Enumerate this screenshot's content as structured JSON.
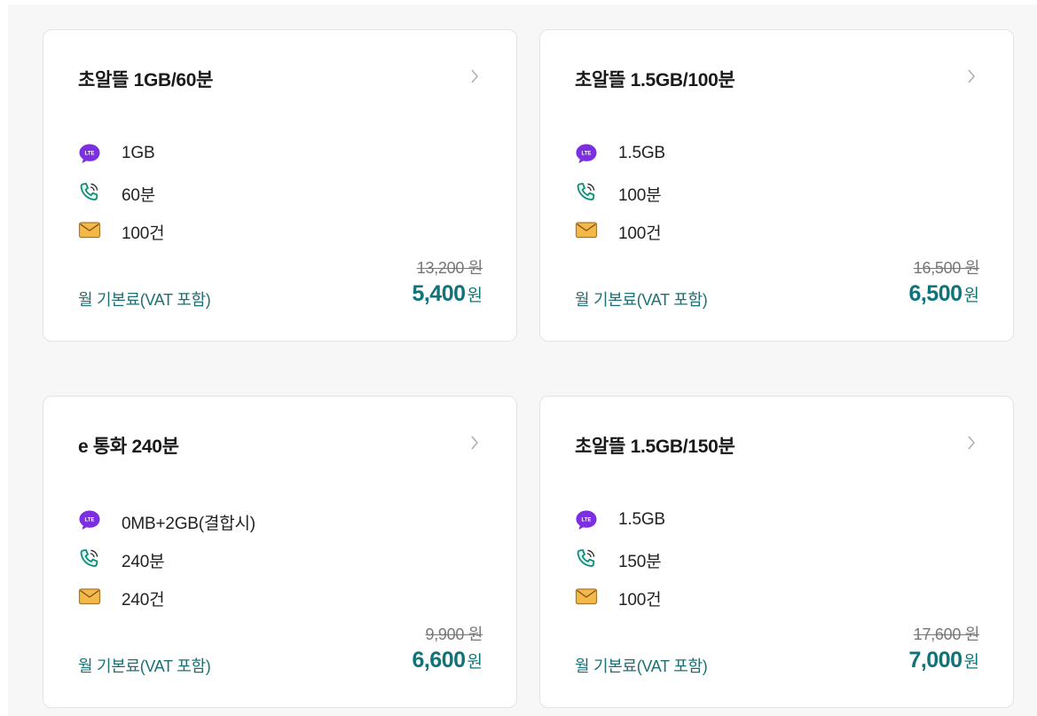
{
  "plans": [
    {
      "title": "초알뜰 1GB/60분",
      "features": {
        "data": "1GB",
        "voice": "60분",
        "sms": "100건"
      },
      "original_price": "13,200 원",
      "fee_label": "월 기본료(VAT 포함)",
      "price": "5,400",
      "price_unit": "원"
    },
    {
      "title": "초알뜰 1.5GB/100분",
      "features": {
        "data": "1.5GB",
        "voice": "100분",
        "sms": "100건"
      },
      "original_price": "16,500 원",
      "fee_label": "월 기본료(VAT 포함)",
      "price": "6,500",
      "price_unit": "원"
    },
    {
      "title": "e 통화 240분",
      "features": {
        "data": "0MB+2GB(결합시)",
        "voice": "240분",
        "sms": "240건"
      },
      "original_price": "9,900 원",
      "fee_label": "월 기본료(VAT 포함)",
      "price": "6,600",
      "price_unit": "원"
    },
    {
      "title": "초알뜰 1.5GB/150분",
      "features": {
        "data": "1.5GB",
        "voice": "150분",
        "sms": "100건"
      },
      "original_price": "17,600 원",
      "fee_label": "월 기본료(VAT 포함)",
      "price": "7,000",
      "price_unit": "원"
    }
  ],
  "icons": {
    "data": "lte-icon",
    "data_badge_text": "LTE",
    "voice": "phone-icon",
    "sms": "envelope-icon",
    "more": "chevron-right-icon"
  },
  "colors": {
    "accent": "#0f7377",
    "lte": "#7b2fe0",
    "phone": "#0e8c7a",
    "envelope": "#f5b94a",
    "strike": "#777777"
  }
}
